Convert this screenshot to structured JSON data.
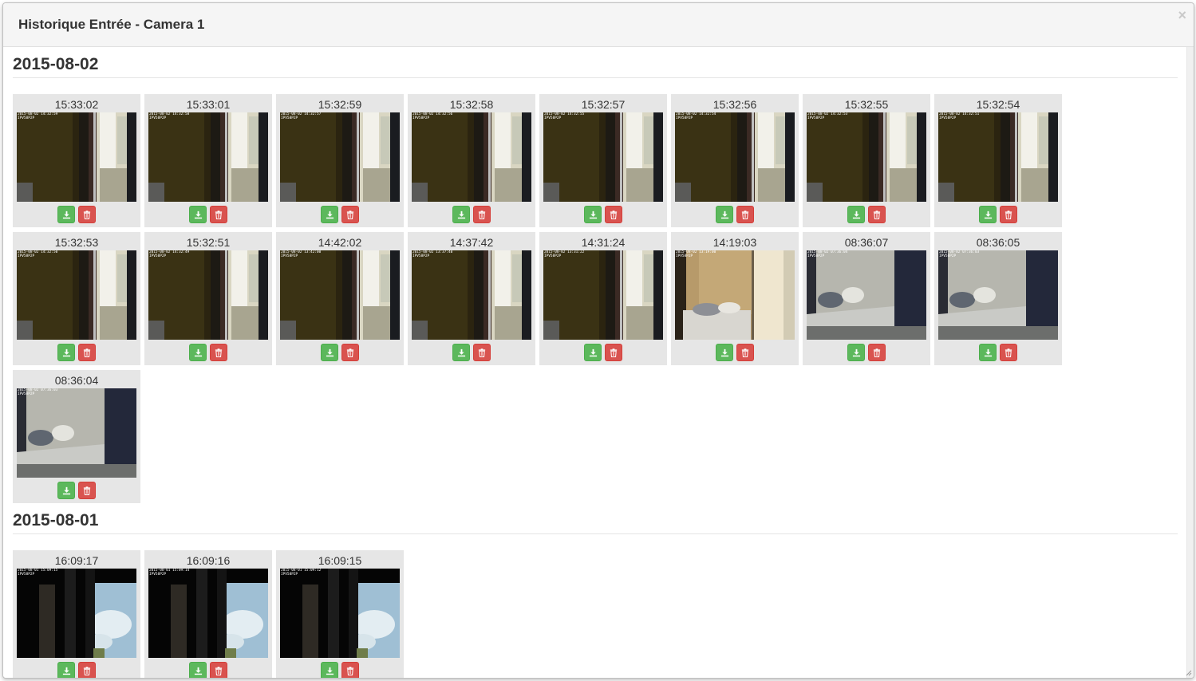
{
  "modal": {
    "title": "Historique Entrée - Camera 1",
    "close_label": "×"
  },
  "days": [
    {
      "date": "2015-08-02",
      "shots": [
        {
          "time": "15:33:02",
          "stamp": "2015-08-02 14:32:59",
          "scene": "window"
        },
        {
          "time": "15:33:01",
          "stamp": "2015-08-02 14:32:58",
          "scene": "window"
        },
        {
          "time": "15:32:59",
          "stamp": "2015-08-02 14:32:57",
          "scene": "window"
        },
        {
          "time": "15:32:58",
          "stamp": "2015-08-02 14:32:56",
          "scene": "window"
        },
        {
          "time": "15:32:57",
          "stamp": "2015-08-02 14:32:55",
          "scene": "window"
        },
        {
          "time": "15:32:56",
          "stamp": "2015-08-02 14:32:54",
          "scene": "window"
        },
        {
          "time": "15:32:55",
          "stamp": "2015-08-02 14:32:53",
          "scene": "window"
        },
        {
          "time": "15:32:54",
          "stamp": "2015-08-02 14:32:51",
          "scene": "window"
        },
        {
          "time": "15:32:53",
          "stamp": "2015-08-02 14:32:50",
          "scene": "window"
        },
        {
          "time": "15:32:51",
          "stamp": "2015-08-02 14:32:49",
          "scene": "window"
        },
        {
          "time": "14:42:02",
          "stamp": "2015-08-02 13:42:00",
          "scene": "window"
        },
        {
          "time": "14:37:42",
          "stamp": "2015-08-02 13:37:40",
          "scene": "window"
        },
        {
          "time": "14:31:24",
          "stamp": "2015-08-02 13:31:22",
          "scene": "window"
        },
        {
          "time": "14:19:03",
          "stamp": "2015-08-02 13:19:00",
          "scene": "room"
        },
        {
          "time": "08:36:07",
          "stamp": "2015-08-02 07:36:04",
          "scene": "bed"
        },
        {
          "time": "08:36:05",
          "stamp": "2015-08-02 07:36:03",
          "scene": "bed"
        },
        {
          "time": "08:36:04",
          "stamp": "2015-08-02 07:36:03",
          "scene": "bed"
        }
      ]
    },
    {
      "date": "2015-08-01",
      "shots": [
        {
          "time": "16:09:17",
          "stamp": "2015-08-01 15:09:15",
          "scene": "sky"
        },
        {
          "time": "16:09:16",
          "stamp": "2015-08-01 15:09:14",
          "scene": "sky"
        },
        {
          "time": "16:09:15",
          "stamp": "2015-08-01 15:09:12",
          "scene": "sky"
        }
      ]
    }
  ],
  "camera_label": "IPV58P2P",
  "icons": {
    "download": "download-icon",
    "delete": "trash-icon"
  },
  "colors": {
    "download": "#5cb85c",
    "delete": "#d9534f"
  }
}
